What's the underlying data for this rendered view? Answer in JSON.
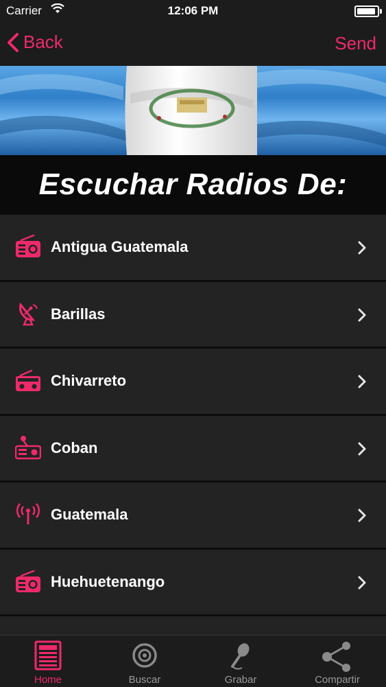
{
  "status_bar": {
    "carrier": "Carrier",
    "time": "12:06 PM",
    "battery_level": 0.9
  },
  "nav": {
    "back_label": "Back",
    "send_label": "Send"
  },
  "banner": {
    "image": "guatemala-flag",
    "colors": {
      "blue": "#3f8fd6",
      "white": "#f2f2f2"
    }
  },
  "heading": {
    "text": "Escuchar Radios De:"
  },
  "list": {
    "items": [
      {
        "label": "Antigua Guatemala",
        "icon": "radio-icon"
      },
      {
        "label": "Barillas",
        "icon": "satellite-dish-icon"
      },
      {
        "label": "Chivarreto",
        "icon": "radio-icon"
      },
      {
        "label": "Coban",
        "icon": "radio-antenna-icon"
      },
      {
        "label": "Guatemala",
        "icon": "broadcast-tower-icon"
      },
      {
        "label": "Huehuetenango",
        "icon": "radio-icon"
      }
    ]
  },
  "tabbar": {
    "tabs": [
      {
        "label": "Home",
        "icon": "home-icon",
        "active": true
      },
      {
        "label": "Buscar",
        "icon": "search-target-icon",
        "active": false
      },
      {
        "label": "Grabar",
        "icon": "microphone-icon",
        "active": false
      },
      {
        "label": "Compartir",
        "icon": "share-icon",
        "active": false
      }
    ]
  },
  "colors": {
    "accent": "#ee2a6b",
    "background": "#1c1c1c",
    "row": "#232323",
    "inactive": "#9a9a9a"
  }
}
